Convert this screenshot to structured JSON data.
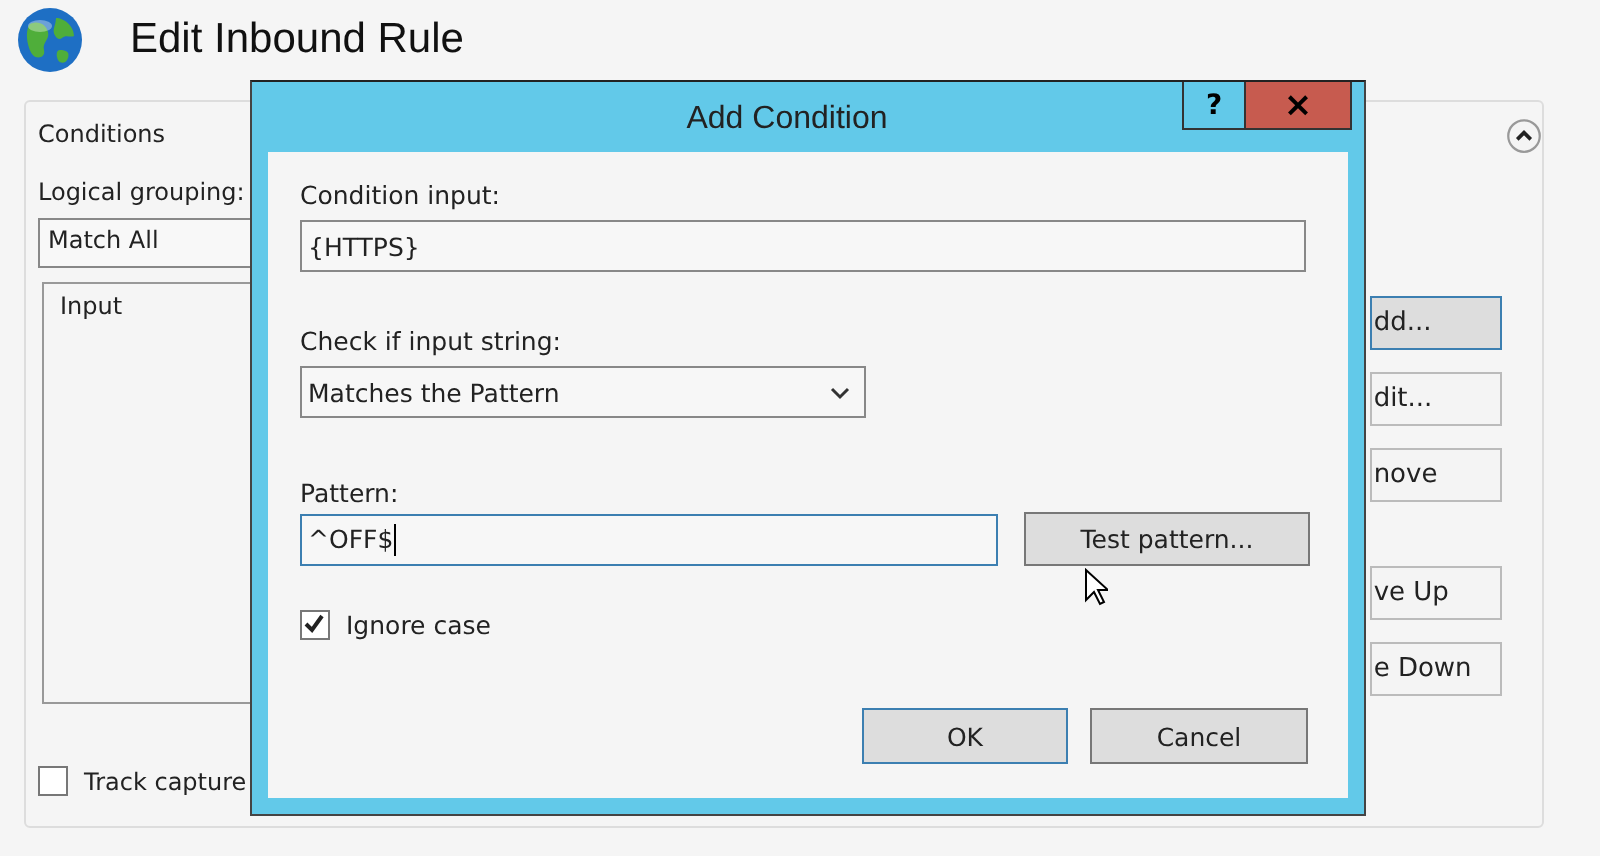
{
  "window": {
    "title": "Edit Inbound Rule"
  },
  "conditions": {
    "heading": "Conditions",
    "expanded": true,
    "grouping_label": "Logical grouping:",
    "grouping_value": "Match All",
    "table": {
      "columns": [
        "Input"
      ]
    },
    "buttons": [
      {
        "label": "dd...",
        "default": true
      },
      {
        "label": "dit...",
        "default": false
      },
      {
        "label": "nove",
        "default": false
      },
      {
        "label": "ve Up",
        "default": false
      },
      {
        "label": "e Down",
        "default": false
      }
    ],
    "track_capture": {
      "label": "Track capture",
      "checked": false
    }
  },
  "dialog": {
    "title": "Add Condition",
    "help": "?",
    "close": "×",
    "condition_input": {
      "label": "Condition input:",
      "value": "{HTTPS}"
    },
    "check": {
      "label": "Check if input string:",
      "value": "Matches the Pattern"
    },
    "pattern": {
      "label": "Pattern:",
      "value": "^OFF$",
      "test_button": "Test pattern..."
    },
    "ignore_case": {
      "label": "Ignore case",
      "checked": true
    },
    "buttons": [
      {
        "label": "OK",
        "default": true
      },
      {
        "label": "Cancel",
        "default": false
      }
    ]
  }
}
